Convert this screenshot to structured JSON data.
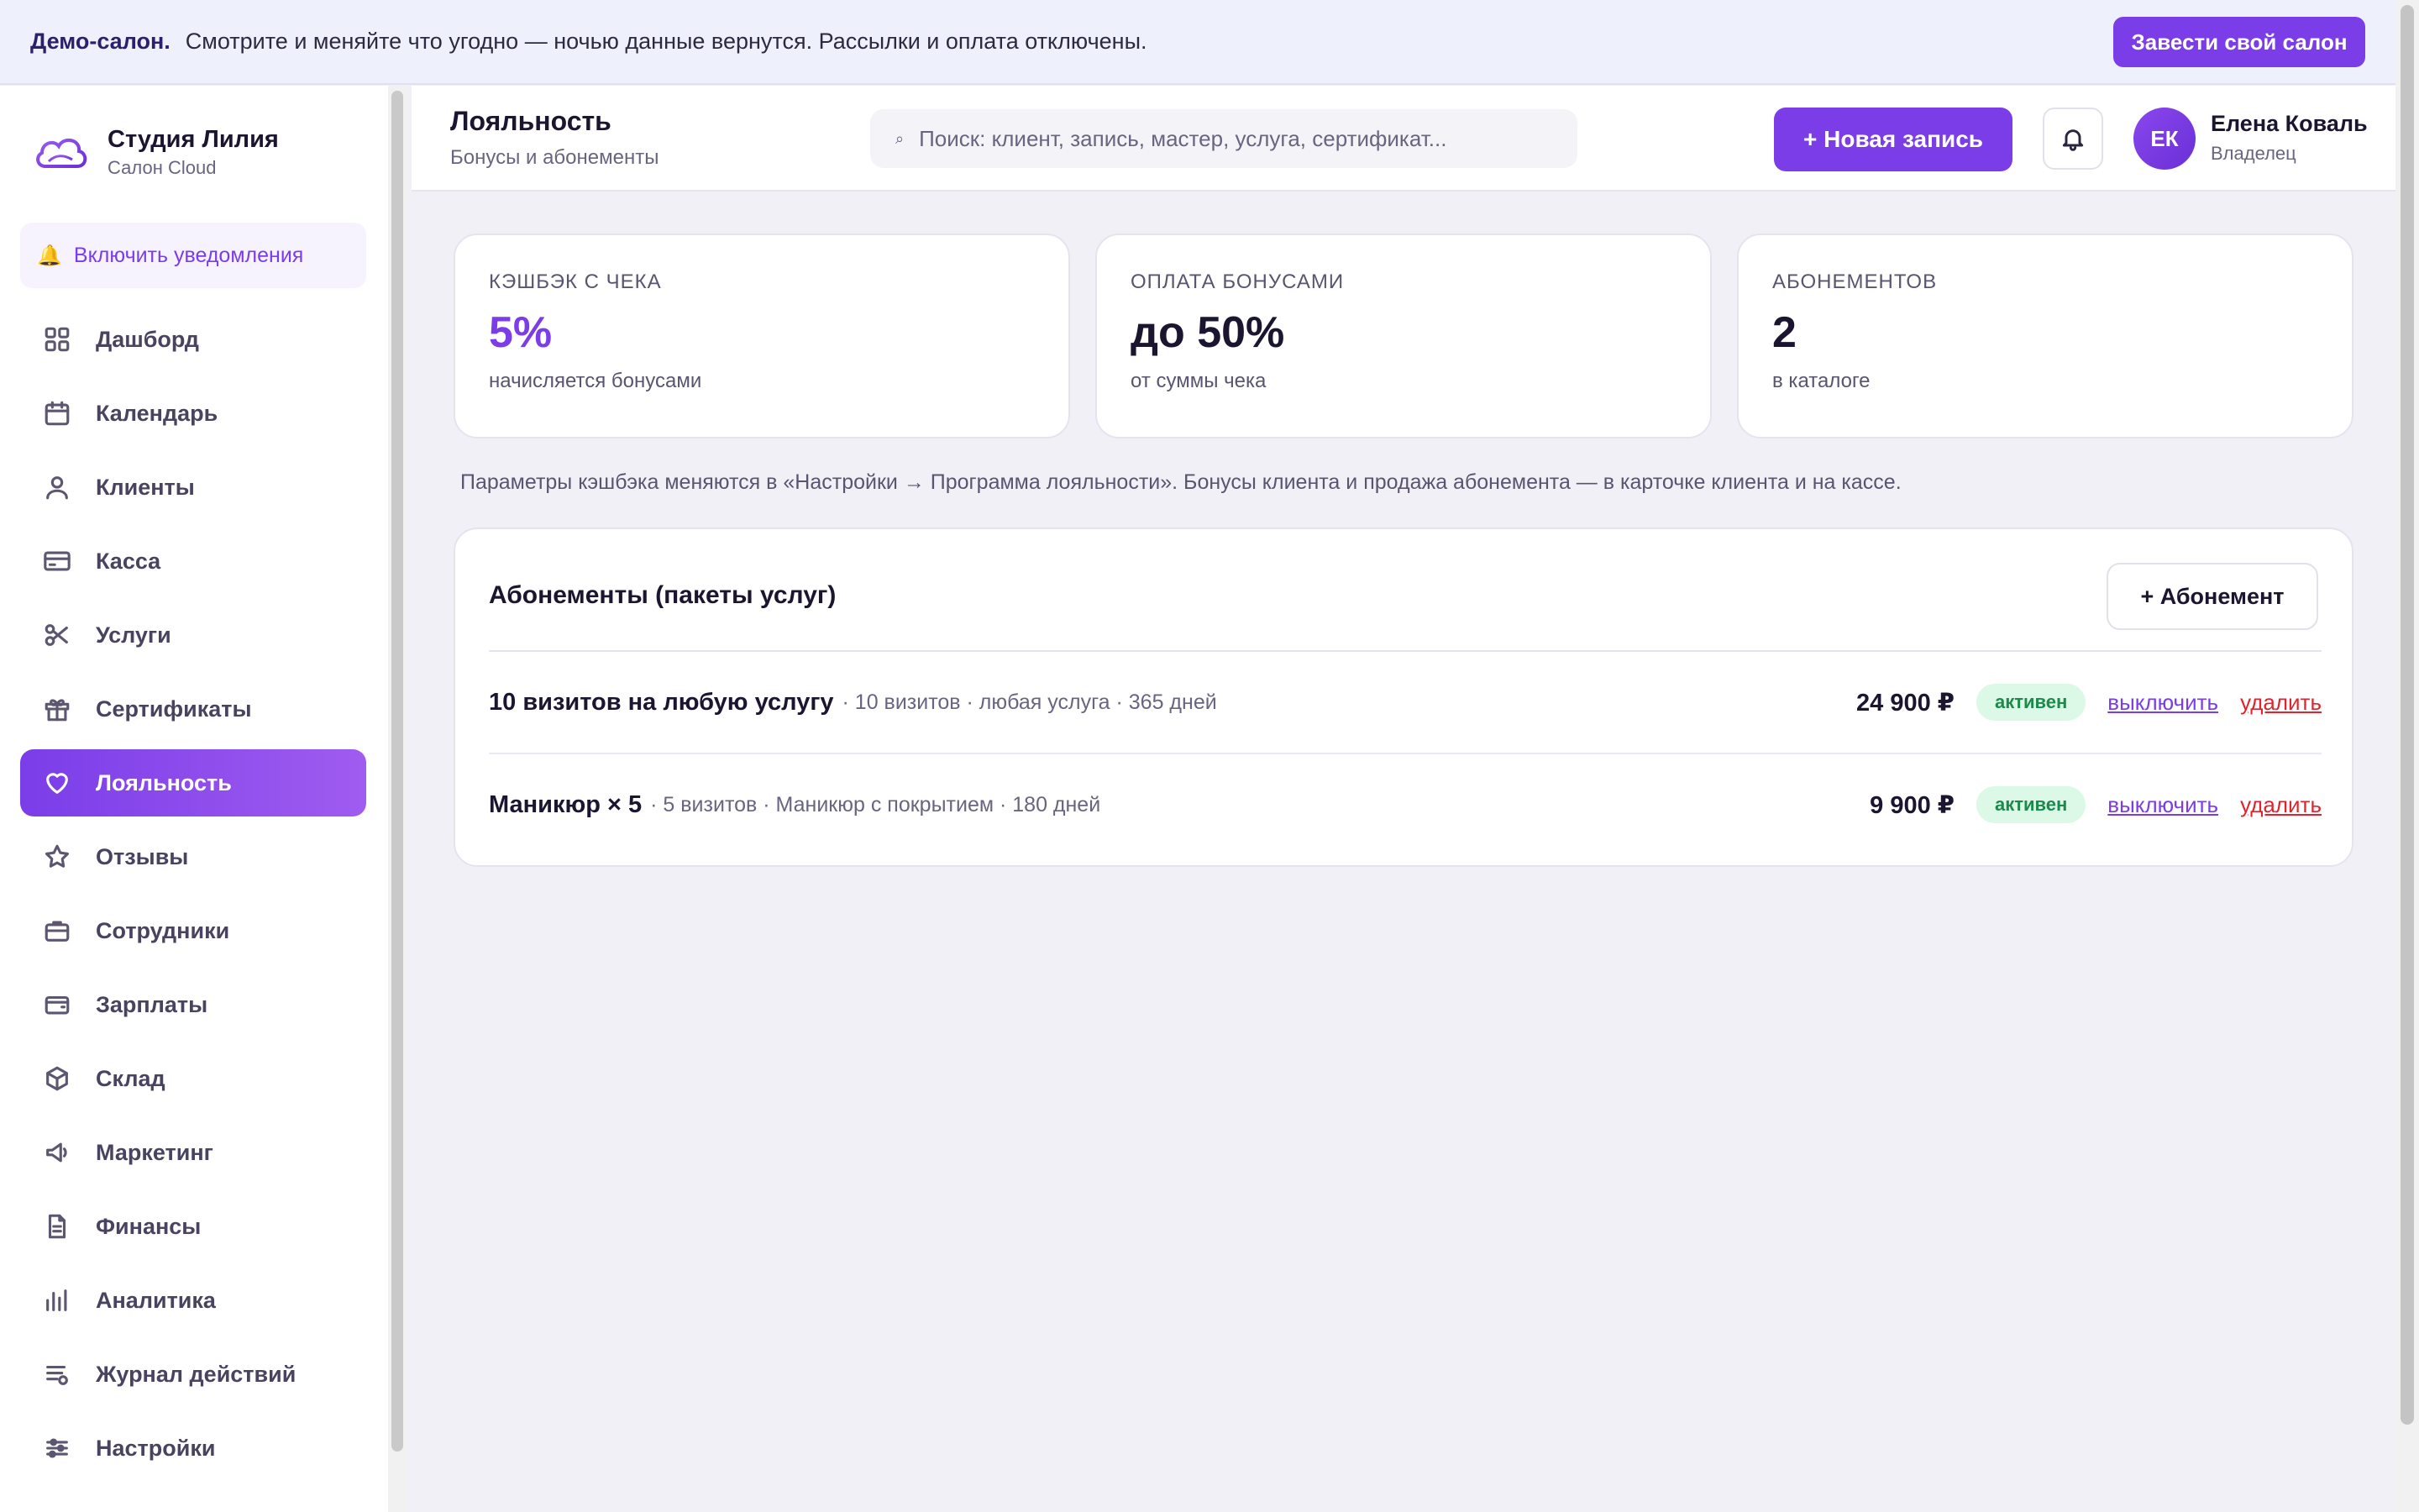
{
  "banner": {
    "strong": "Демо-салон.",
    "text": "Смотрите и меняйте что угодно — ночью данные вернутся. Рассылки и оплата отключены.",
    "button": "Завести свой салон"
  },
  "brand": {
    "title": "Студия Лилия",
    "subtitle": "Салон Cloud",
    "logo_icon": "cloud-icon"
  },
  "notify": {
    "label": "Включить уведомления",
    "icon": "bell-icon"
  },
  "sidebar": {
    "items": [
      {
        "label": "Дашборд",
        "icon": "grid-icon"
      },
      {
        "label": "Календарь",
        "icon": "calendar-icon"
      },
      {
        "label": "Клиенты",
        "icon": "user-icon"
      },
      {
        "label": "Касса",
        "icon": "card-icon"
      },
      {
        "label": "Услуги",
        "icon": "scissors-icon"
      },
      {
        "label": "Сертификаты",
        "icon": "gift-icon"
      },
      {
        "label": "Лояльность",
        "icon": "heart-icon",
        "active": true
      },
      {
        "label": "Отзывы",
        "icon": "star-icon"
      },
      {
        "label": "Сотрудники",
        "icon": "briefcase-icon"
      },
      {
        "label": "Зарплаты",
        "icon": "wallet-icon"
      },
      {
        "label": "Склад",
        "icon": "box-icon"
      },
      {
        "label": "Маркетинг",
        "icon": "megaphone-icon"
      },
      {
        "label": "Финансы",
        "icon": "document-icon"
      },
      {
        "label": "Аналитика",
        "icon": "bar-chart-icon"
      },
      {
        "label": "Журнал действий",
        "icon": "log-icon"
      },
      {
        "label": "Настройки",
        "icon": "sliders-icon"
      }
    ]
  },
  "header": {
    "title": "Лояльность",
    "subtitle": "Бонусы и абонементы",
    "search_placeholder": "Поиск: клиент, запись, мастер, услуга, сертификат...",
    "new_button": "+ Новая запись",
    "user_initials": "ЕК",
    "user_name": "Елена Коваль",
    "user_role": "Владелец"
  },
  "stats": [
    {
      "label": "КЭШБЭК С ЧЕКА",
      "value": "5%",
      "note": "начисляется бонусами"
    },
    {
      "label": "ОПЛАТА БОНУСАМИ",
      "value": "до 50%",
      "note": "от суммы чека"
    },
    {
      "label": "АБОНЕМЕНТОВ",
      "value": "2",
      "note": "в каталоге"
    }
  ],
  "hint": "Параметры кэшбэка меняются в «Настройки → Программа лояльности». Бонусы клиента и продажа абонемента — в карточке клиента и на кассе.",
  "subscriptions": {
    "title": "Абонементы (пакеты услуг)",
    "add_button": "+ Абонемент",
    "rows": [
      {
        "name": "10 визитов на любую услугу",
        "meta": "· 10 визитов · любая услуга · 365 дней",
        "price": "24 900 ₽",
        "status": "активен",
        "disable": "выключить",
        "delete": "удалить"
      },
      {
        "name": "Маникюр × 5",
        "meta": "· 5 визитов · Маникюр с покрытием · 180 дней",
        "price": "9 900 ₽",
        "status": "активен",
        "disable": "выключить",
        "delete": "удалить"
      }
    ]
  },
  "colors": {
    "accent": "#7a3de8",
    "danger": "#e0242e",
    "success": "#1d8a4b"
  }
}
